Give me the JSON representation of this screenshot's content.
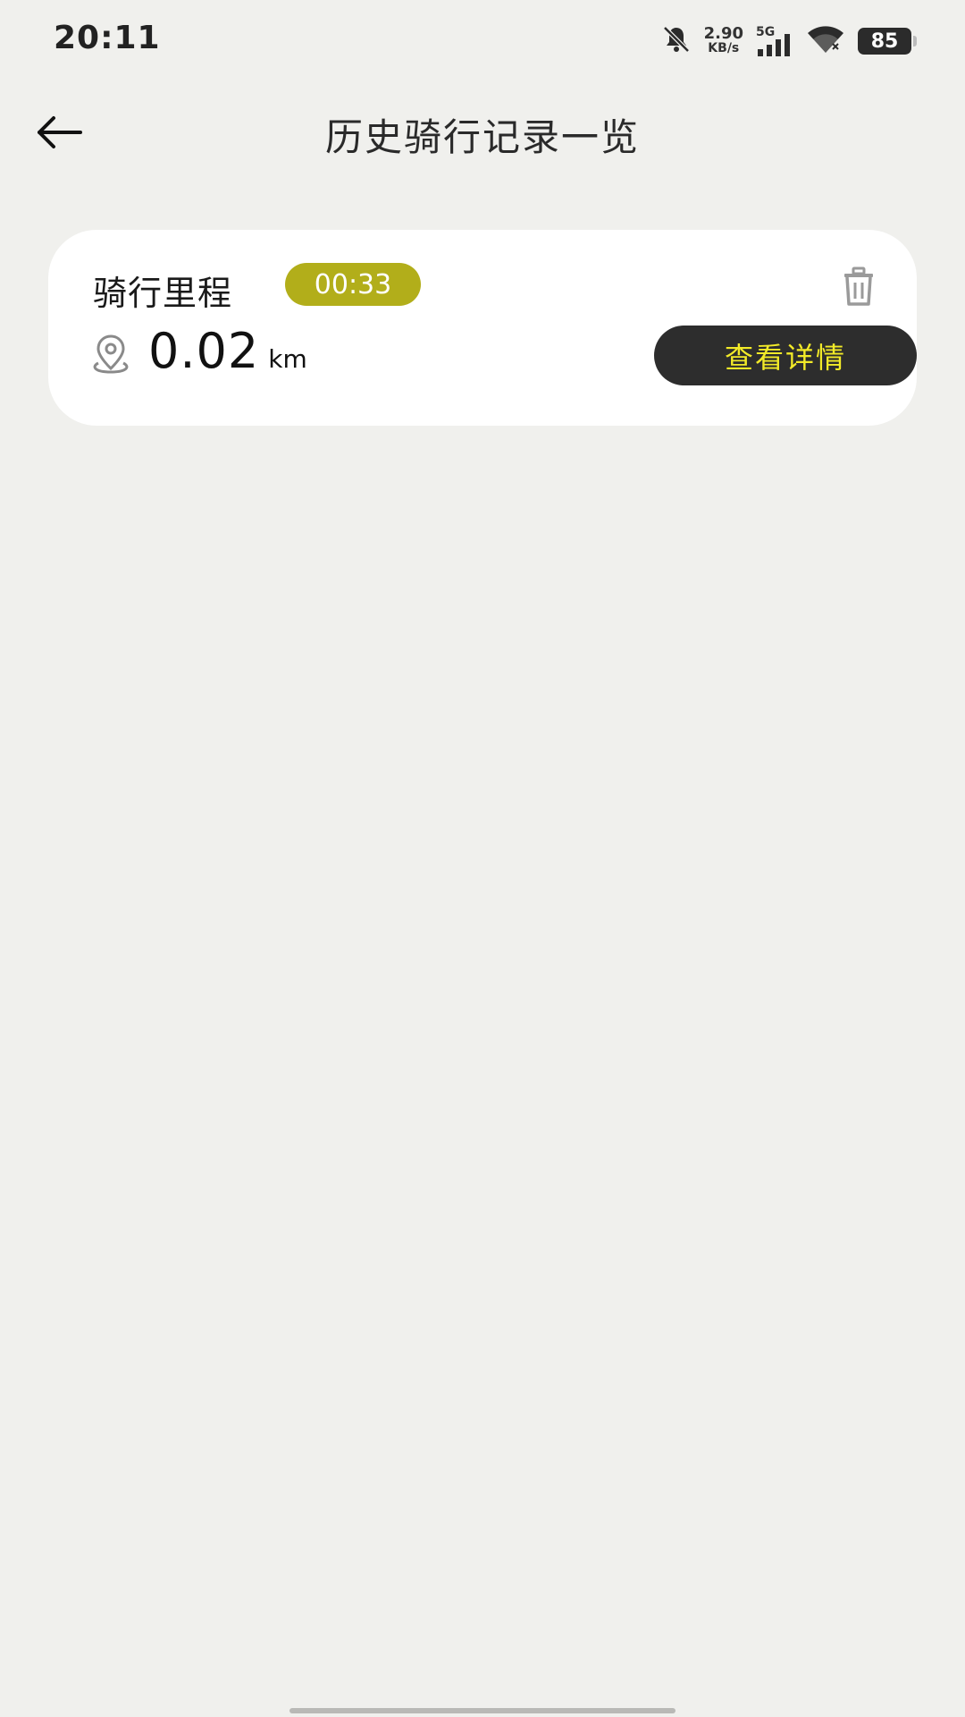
{
  "status_bar": {
    "time": "20:11",
    "net_speed_value": "2.90",
    "net_speed_unit": "KB/s",
    "network_type": "5G",
    "battery_level": "85",
    "icons": [
      "bell-muted-icon",
      "signal-icon",
      "wifi-icon",
      "battery-icon"
    ]
  },
  "header": {
    "title": "历史骑行记录一览",
    "back_icon": "arrow-left-icon"
  },
  "records": [
    {
      "title": "骑行里程",
      "duration": "00:33",
      "distance": "0.02",
      "unit": "km",
      "detail_label": "查看详情",
      "delete_icon": "trash-icon",
      "location_icon": "location-pin-icon"
    }
  ],
  "colors": {
    "background": "#f0f0ed",
    "card": "#ffffff",
    "badge": "#b2ae1a",
    "button_bg": "#2d2d2d",
    "button_text": "#f2ea28"
  }
}
